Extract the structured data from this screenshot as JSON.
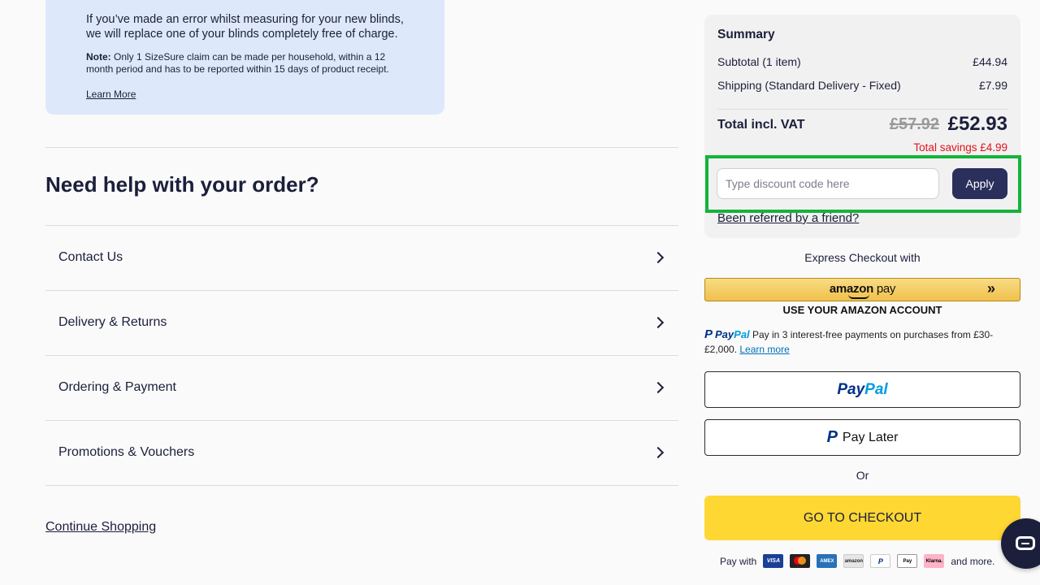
{
  "sizesure": {
    "main_text": "If you’ve made an error whilst measuring for your new blinds, we will replace one of your blinds completely free of charge.",
    "note_label": "Note:",
    "note_text": " Only 1 SizeSure claim can be made per household, within a 12 month period and has to be reported within 15 days of product receipt.",
    "learn_more": "Learn More"
  },
  "help": {
    "title": "Need help with your order?",
    "items": [
      {
        "label": "Contact Us"
      },
      {
        "label": "Delivery & Returns"
      },
      {
        "label": "Ordering & Payment"
      },
      {
        "label": "Promotions & Vouchers"
      }
    ],
    "continue_shopping": "Continue Shopping"
  },
  "summary": {
    "title": "Summary",
    "subtotal_label": "Subtotal (1 item)",
    "subtotal_value": "£44.94",
    "shipping_label": "Shipping (Standard Delivery - Fixed)",
    "shipping_value": "£7.99",
    "total_label": "Total incl. VAT",
    "old_total": "£57.92",
    "new_total": "£52.93",
    "savings": "Total savings £4.99"
  },
  "discount": {
    "placeholder": "Type discount code here",
    "value": "",
    "apply_label": "Apply",
    "highlight_color": "#12b43a"
  },
  "referred_link": "Been referred by a friend?",
  "express": {
    "heading": "Express Checkout with",
    "amazon_logo_amazon": "amazon",
    "amazon_logo_pay": " pay",
    "amazon_arrows": "»",
    "amazon_sub": "USE YOUR AMAZON ACCOUNT"
  },
  "paypal_info": {
    "logo_p": "P",
    "logo_pay": "Pay",
    "logo_pal": "Pal",
    "text": " Pay in 3 interest-free payments on purchases from £30-£2,000. ",
    "learn_more": "Learn more"
  },
  "paypal_button": {
    "pay": "Pay",
    "pal": "Pal"
  },
  "paylater_button": {
    "p": "P",
    "label": "Pay Later"
  },
  "or_text": "Or",
  "checkout_label": "GO TO CHECKOUT",
  "pay_with": {
    "label": "Pay with",
    "methods": [
      {
        "name": "visa",
        "text": "VISA"
      },
      {
        "name": "mastercard",
        "text": ""
      },
      {
        "name": "amex",
        "text": "AMEX"
      },
      {
        "name": "amazon",
        "text": "amazon"
      },
      {
        "name": "paypal",
        "text": "P"
      },
      {
        "name": "apple-pay",
        "text": "Pay"
      },
      {
        "name": "klarna",
        "text": "Klarna."
      }
    ],
    "more": "and more."
  },
  "colors": {
    "navy": "#1c1f3b",
    "apply_bg": "#2a2f5c",
    "checkout_yellow": "#fed733",
    "savings_red": "#e2121d",
    "info_blue": "#dde9fb"
  },
  "icons": {
    "chat": "chat-bubble-icon",
    "chevron": "chevron-right-icon"
  }
}
